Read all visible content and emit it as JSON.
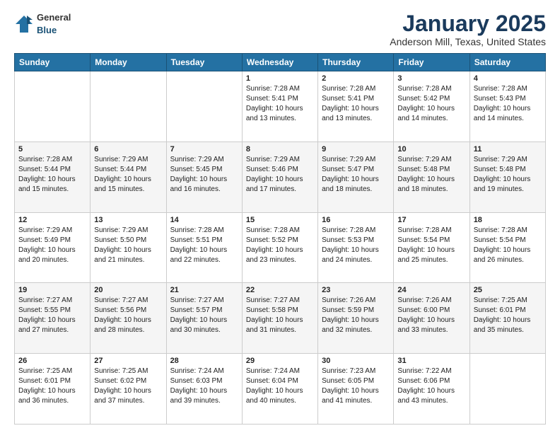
{
  "header": {
    "logo": {
      "general": "General",
      "blue": "Blue"
    },
    "title": "January 2025",
    "subtitle": "Anderson Mill, Texas, United States"
  },
  "days_of_week": [
    "Sunday",
    "Monday",
    "Tuesday",
    "Wednesday",
    "Thursday",
    "Friday",
    "Saturday"
  ],
  "weeks": [
    [
      {
        "day": "",
        "info": ""
      },
      {
        "day": "",
        "info": ""
      },
      {
        "day": "",
        "info": ""
      },
      {
        "day": "1",
        "info": "Sunrise: 7:28 AM\nSunset: 5:41 PM\nDaylight: 10 hours\nand 13 minutes."
      },
      {
        "day": "2",
        "info": "Sunrise: 7:28 AM\nSunset: 5:41 PM\nDaylight: 10 hours\nand 13 minutes."
      },
      {
        "day": "3",
        "info": "Sunrise: 7:28 AM\nSunset: 5:42 PM\nDaylight: 10 hours\nand 14 minutes."
      },
      {
        "day": "4",
        "info": "Sunrise: 7:28 AM\nSunset: 5:43 PM\nDaylight: 10 hours\nand 14 minutes."
      }
    ],
    [
      {
        "day": "5",
        "info": "Sunrise: 7:28 AM\nSunset: 5:44 PM\nDaylight: 10 hours\nand 15 minutes."
      },
      {
        "day": "6",
        "info": "Sunrise: 7:29 AM\nSunset: 5:44 PM\nDaylight: 10 hours\nand 15 minutes."
      },
      {
        "day": "7",
        "info": "Sunrise: 7:29 AM\nSunset: 5:45 PM\nDaylight: 10 hours\nand 16 minutes."
      },
      {
        "day": "8",
        "info": "Sunrise: 7:29 AM\nSunset: 5:46 PM\nDaylight: 10 hours\nand 17 minutes."
      },
      {
        "day": "9",
        "info": "Sunrise: 7:29 AM\nSunset: 5:47 PM\nDaylight: 10 hours\nand 18 minutes."
      },
      {
        "day": "10",
        "info": "Sunrise: 7:29 AM\nSunset: 5:48 PM\nDaylight: 10 hours\nand 18 minutes."
      },
      {
        "day": "11",
        "info": "Sunrise: 7:29 AM\nSunset: 5:48 PM\nDaylight: 10 hours\nand 19 minutes."
      }
    ],
    [
      {
        "day": "12",
        "info": "Sunrise: 7:29 AM\nSunset: 5:49 PM\nDaylight: 10 hours\nand 20 minutes."
      },
      {
        "day": "13",
        "info": "Sunrise: 7:29 AM\nSunset: 5:50 PM\nDaylight: 10 hours\nand 21 minutes."
      },
      {
        "day": "14",
        "info": "Sunrise: 7:28 AM\nSunset: 5:51 PM\nDaylight: 10 hours\nand 22 minutes."
      },
      {
        "day": "15",
        "info": "Sunrise: 7:28 AM\nSunset: 5:52 PM\nDaylight: 10 hours\nand 23 minutes."
      },
      {
        "day": "16",
        "info": "Sunrise: 7:28 AM\nSunset: 5:53 PM\nDaylight: 10 hours\nand 24 minutes."
      },
      {
        "day": "17",
        "info": "Sunrise: 7:28 AM\nSunset: 5:54 PM\nDaylight: 10 hours\nand 25 minutes."
      },
      {
        "day": "18",
        "info": "Sunrise: 7:28 AM\nSunset: 5:54 PM\nDaylight: 10 hours\nand 26 minutes."
      }
    ],
    [
      {
        "day": "19",
        "info": "Sunrise: 7:27 AM\nSunset: 5:55 PM\nDaylight: 10 hours\nand 27 minutes."
      },
      {
        "day": "20",
        "info": "Sunrise: 7:27 AM\nSunset: 5:56 PM\nDaylight: 10 hours\nand 28 minutes."
      },
      {
        "day": "21",
        "info": "Sunrise: 7:27 AM\nSunset: 5:57 PM\nDaylight: 10 hours\nand 30 minutes."
      },
      {
        "day": "22",
        "info": "Sunrise: 7:27 AM\nSunset: 5:58 PM\nDaylight: 10 hours\nand 31 minutes."
      },
      {
        "day": "23",
        "info": "Sunrise: 7:26 AM\nSunset: 5:59 PM\nDaylight: 10 hours\nand 32 minutes."
      },
      {
        "day": "24",
        "info": "Sunrise: 7:26 AM\nSunset: 6:00 PM\nDaylight: 10 hours\nand 33 minutes."
      },
      {
        "day": "25",
        "info": "Sunrise: 7:25 AM\nSunset: 6:01 PM\nDaylight: 10 hours\nand 35 minutes."
      }
    ],
    [
      {
        "day": "26",
        "info": "Sunrise: 7:25 AM\nSunset: 6:01 PM\nDaylight: 10 hours\nand 36 minutes."
      },
      {
        "day": "27",
        "info": "Sunrise: 7:25 AM\nSunset: 6:02 PM\nDaylight: 10 hours\nand 37 minutes."
      },
      {
        "day": "28",
        "info": "Sunrise: 7:24 AM\nSunset: 6:03 PM\nDaylight: 10 hours\nand 39 minutes."
      },
      {
        "day": "29",
        "info": "Sunrise: 7:24 AM\nSunset: 6:04 PM\nDaylight: 10 hours\nand 40 minutes."
      },
      {
        "day": "30",
        "info": "Sunrise: 7:23 AM\nSunset: 6:05 PM\nDaylight: 10 hours\nand 41 minutes."
      },
      {
        "day": "31",
        "info": "Sunrise: 7:22 AM\nSunset: 6:06 PM\nDaylight: 10 hours\nand 43 minutes."
      },
      {
        "day": "",
        "info": ""
      }
    ]
  ]
}
